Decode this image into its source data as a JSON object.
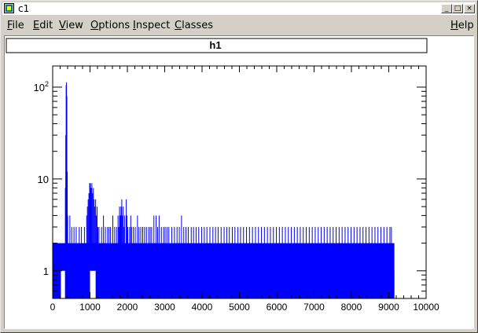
{
  "window": {
    "title": "c1",
    "buttons": {
      "minimize": "_",
      "maximize": "□",
      "close": "×"
    }
  },
  "menu": {
    "items": [
      {
        "label": "File",
        "accel": "F"
      },
      {
        "label": "Edit",
        "accel": "E"
      },
      {
        "label": "View",
        "accel": "V"
      },
      {
        "label": "Options",
        "accel": "O"
      },
      {
        "label": "Inspect",
        "accel": "I"
      },
      {
        "label": "Classes",
        "accel": "C"
      }
    ],
    "help": {
      "label": "Help",
      "accel": "H"
    }
  },
  "colors": {
    "histogram": "#0000ff",
    "frame": "#000000",
    "canvas": "#ffffff"
  },
  "chart_data": {
    "type": "bar",
    "title": "h1",
    "xlabel": "",
    "ylabel": "",
    "xlim": [
      0,
      10000
    ],
    "ylim": [
      0.5,
      170
    ],
    "log_y": true,
    "grid": false,
    "x_ticks": [
      "0",
      "1000",
      "2000",
      "3000",
      "4000",
      "5000",
      "6000",
      "7000",
      "8000",
      "9000",
      "10000"
    ],
    "y_ticks": [
      {
        "value": 1,
        "label": "1"
      },
      {
        "value": 10,
        "label": "10"
      },
      {
        "value": 100,
        "label": "10",
        "exp": "2"
      }
    ],
    "bin_width": 10,
    "bins": [
      {
        "x": 320,
        "y": 2
      },
      {
        "x": 330,
        "y": 8
      },
      {
        "x": 340,
        "y": 30
      },
      {
        "x": 350,
        "y": 105
      },
      {
        "x": 360,
        "y": 113
      },
      {
        "x": 370,
        "y": 80
      },
      {
        "x": 380,
        "y": 12
      },
      {
        "x": 390,
        "y": 4
      },
      {
        "x": 450,
        "y": 4
      },
      {
        "x": 500,
        "y": 3
      },
      {
        "x": 560,
        "y": 3
      },
      {
        "x": 620,
        "y": 3
      },
      {
        "x": 700,
        "y": 3
      },
      {
        "x": 760,
        "y": 3
      },
      {
        "x": 840,
        "y": 3
      },
      {
        "x": 900,
        "y": 4
      },
      {
        "x": 920,
        "y": 5
      },
      {
        "x": 940,
        "y": 6
      },
      {
        "x": 960,
        "y": 7
      },
      {
        "x": 980,
        "y": 9
      },
      {
        "x": 1000,
        "y": 9
      },
      {
        "x": 1020,
        "y": 8
      },
      {
        "x": 1040,
        "y": 9
      },
      {
        "x": 1060,
        "y": 7
      },
      {
        "x": 1080,
        "y": 8
      },
      {
        "x": 1100,
        "y": 6
      },
      {
        "x": 1120,
        "y": 5
      },
      {
        "x": 1140,
        "y": 6
      },
      {
        "x": 1160,
        "y": 4
      },
      {
        "x": 1180,
        "y": 5
      },
      {
        "x": 1200,
        "y": 3
      },
      {
        "x": 1230,
        "y": 3
      },
      {
        "x": 1300,
        "y": 3
      },
      {
        "x": 1350,
        "y": 4
      },
      {
        "x": 1400,
        "y": 3
      },
      {
        "x": 1460,
        "y": 3
      },
      {
        "x": 1500,
        "y": 3
      },
      {
        "x": 1540,
        "y": 3
      },
      {
        "x": 1600,
        "y": 4
      },
      {
        "x": 1650,
        "y": 3
      },
      {
        "x": 1700,
        "y": 3
      },
      {
        "x": 1740,
        "y": 4
      },
      {
        "x": 1760,
        "y": 3
      },
      {
        "x": 1780,
        "y": 5
      },
      {
        "x": 1800,
        "y": 4
      },
      {
        "x": 1820,
        "y": 5
      },
      {
        "x": 1840,
        "y": 6
      },
      {
        "x": 1860,
        "y": 4
      },
      {
        "x": 1880,
        "y": 5
      },
      {
        "x": 1900,
        "y": 3
      },
      {
        "x": 1920,
        "y": 4
      },
      {
        "x": 1960,
        "y": 6
      },
      {
        "x": 1980,
        "y": 4
      },
      {
        "x": 2000,
        "y": 3
      },
      {
        "x": 2050,
        "y": 3
      },
      {
        "x": 2080,
        "y": 4
      },
      {
        "x": 2100,
        "y": 3
      },
      {
        "x": 2150,
        "y": 3
      },
      {
        "x": 2200,
        "y": 3
      },
      {
        "x": 2260,
        "y": 4
      },
      {
        "x": 2300,
        "y": 3
      },
      {
        "x": 2350,
        "y": 3
      },
      {
        "x": 2400,
        "y": 3
      },
      {
        "x": 2450,
        "y": 3
      },
      {
        "x": 2500,
        "y": 3
      },
      {
        "x": 2560,
        "y": 3
      },
      {
        "x": 2600,
        "y": 3
      },
      {
        "x": 2640,
        "y": 3
      },
      {
        "x": 2700,
        "y": 4
      },
      {
        "x": 2760,
        "y": 4
      },
      {
        "x": 2800,
        "y": 3
      },
      {
        "x": 2840,
        "y": 4
      },
      {
        "x": 2900,
        "y": 3
      },
      {
        "x": 2960,
        "y": 3
      },
      {
        "x": 3000,
        "y": 3
      },
      {
        "x": 3050,
        "y": 3
      },
      {
        "x": 3100,
        "y": 3
      },
      {
        "x": 3180,
        "y": 3
      },
      {
        "x": 3250,
        "y": 3
      },
      {
        "x": 3320,
        "y": 3
      },
      {
        "x": 3380,
        "y": 3
      },
      {
        "x": 3440,
        "y": 4
      },
      {
        "x": 3500,
        "y": 3
      },
      {
        "x": 3560,
        "y": 3
      },
      {
        "x": 3620,
        "y": 3
      },
      {
        "x": 3700,
        "y": 3
      },
      {
        "x": 3760,
        "y": 3
      },
      {
        "x": 3830,
        "y": 3
      },
      {
        "x": 3900,
        "y": 3
      },
      {
        "x": 3980,
        "y": 3
      },
      {
        "x": 4050,
        "y": 3
      },
      {
        "x": 4120,
        "y": 3
      },
      {
        "x": 4200,
        "y": 3
      },
      {
        "x": 4280,
        "y": 3
      },
      {
        "x": 4350,
        "y": 3
      },
      {
        "x": 4420,
        "y": 3
      },
      {
        "x": 4500,
        "y": 3
      },
      {
        "x": 4580,
        "y": 3
      },
      {
        "x": 4650,
        "y": 3
      },
      {
        "x": 4720,
        "y": 3
      },
      {
        "x": 4800,
        "y": 3
      },
      {
        "x": 4870,
        "y": 3
      },
      {
        "x": 4950,
        "y": 3
      },
      {
        "x": 5020,
        "y": 3
      },
      {
        "x": 5100,
        "y": 3
      },
      {
        "x": 5180,
        "y": 3
      },
      {
        "x": 5260,
        "y": 3
      },
      {
        "x": 5340,
        "y": 3
      },
      {
        "x": 5420,
        "y": 3
      },
      {
        "x": 5500,
        "y": 3
      },
      {
        "x": 5580,
        "y": 3
      },
      {
        "x": 5660,
        "y": 3
      },
      {
        "x": 5740,
        "y": 3
      },
      {
        "x": 5820,
        "y": 3
      },
      {
        "x": 5900,
        "y": 3
      },
      {
        "x": 5980,
        "y": 3
      },
      {
        "x": 6060,
        "y": 3
      },
      {
        "x": 6140,
        "y": 3
      },
      {
        "x": 6220,
        "y": 3
      },
      {
        "x": 6300,
        "y": 3
      },
      {
        "x": 6380,
        "y": 3
      },
      {
        "x": 6460,
        "y": 3
      },
      {
        "x": 6540,
        "y": 3
      },
      {
        "x": 6620,
        "y": 3
      },
      {
        "x": 6700,
        "y": 3
      },
      {
        "x": 6780,
        "y": 3
      },
      {
        "x": 6860,
        "y": 3
      },
      {
        "x": 6940,
        "y": 3
      },
      {
        "x": 7020,
        "y": 3
      },
      {
        "x": 7100,
        "y": 3
      },
      {
        "x": 7180,
        "y": 3
      },
      {
        "x": 7260,
        "y": 3
      },
      {
        "x": 7340,
        "y": 3
      },
      {
        "x": 7420,
        "y": 3
      },
      {
        "x": 7500,
        "y": 3
      },
      {
        "x": 7580,
        "y": 3
      },
      {
        "x": 7660,
        "y": 3
      },
      {
        "x": 7740,
        "y": 3
      },
      {
        "x": 7820,
        "y": 3
      },
      {
        "x": 7900,
        "y": 3
      },
      {
        "x": 7980,
        "y": 3
      },
      {
        "x": 8060,
        "y": 3
      },
      {
        "x": 8140,
        "y": 3
      },
      {
        "x": 8220,
        "y": 3
      },
      {
        "x": 8300,
        "y": 3
      },
      {
        "x": 8380,
        "y": 3
      },
      {
        "x": 8460,
        "y": 3
      },
      {
        "x": 8540,
        "y": 3
      },
      {
        "x": 8620,
        "y": 3
      },
      {
        "x": 8700,
        "y": 3
      },
      {
        "x": 8780,
        "y": 3
      },
      {
        "x": 8860,
        "y": 3
      },
      {
        "x": 8940,
        "y": 3
      },
      {
        "x": 9020,
        "y": 3
      },
      {
        "x": 9060,
        "y": 3
      }
    ],
    "baseline": {
      "value": 2,
      "from": 0,
      "to": 9150
    },
    "floor": {
      "value": 1,
      "from": 400,
      "to": 9150
    },
    "empty_bands": [
      {
        "from": 220,
        "to": 330
      },
      {
        "from": 1000,
        "to": 1150
      }
    ]
  }
}
